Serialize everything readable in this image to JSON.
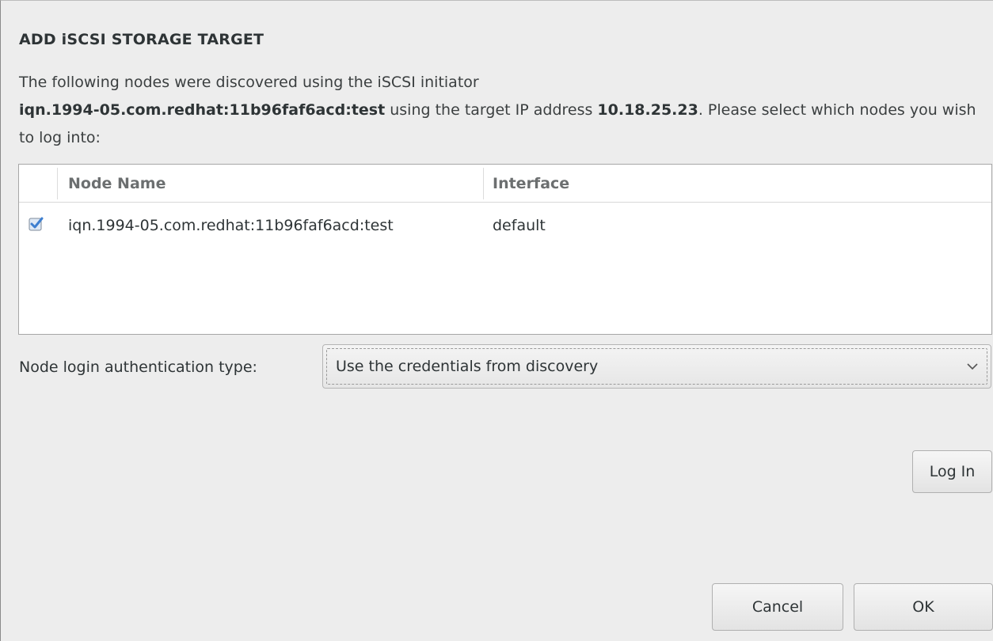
{
  "dialog": {
    "title": "ADD iSCSI STORAGE TARGET",
    "desc_pre": "The following nodes were discovered using the iSCSI initiator",
    "initiator": "iqn.1994-05.com.redhat:11b96faf6acd:test",
    "desc_mid": " using the target IP address ",
    "target_ip": "10.18.25.23",
    "desc_post": ".  Please select which nodes you wish to log into:"
  },
  "table": {
    "columns": [
      "Node Name",
      "Interface"
    ],
    "rows": [
      {
        "checked": true,
        "node_name": "iqn.1994-05.com.redhat:11b96faf6acd:test",
        "interface": "default"
      }
    ]
  },
  "auth": {
    "label": "Node login authentication type:",
    "selected": "Use the credentials from discovery"
  },
  "buttons": {
    "login": "Log In",
    "cancel": "Cancel",
    "ok": "OK"
  },
  "colors": {
    "checkbox_accent": "#4a90d9",
    "background": "#ededed"
  },
  "icons": {
    "checkbox": "checkbox-checked-icon",
    "dropdown": "chevron-down-icon"
  }
}
